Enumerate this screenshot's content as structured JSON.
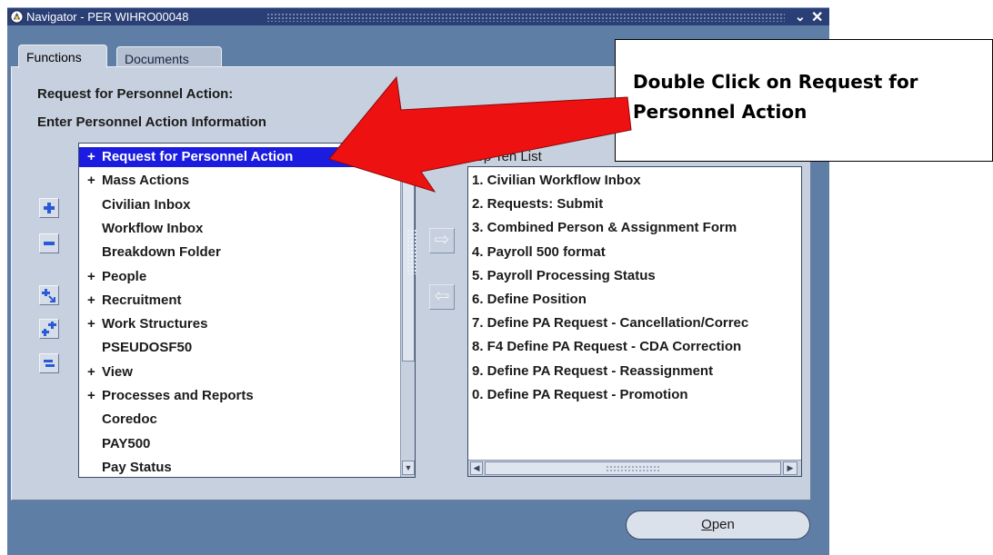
{
  "window": {
    "title": "Navigator - PER WIHRO00048",
    "minimize_glyph": "⌄",
    "close_glyph": "✕"
  },
  "tabs": [
    {
      "label": "Functions",
      "active": true
    },
    {
      "label": "Documents",
      "active": false
    }
  ],
  "header": {
    "line1": "Request for Personnel Action:",
    "line2": "Enter Personnel Action Information"
  },
  "tree": {
    "items": [
      {
        "label": "Request for Personnel Action",
        "expandable": true,
        "selected": true
      },
      {
        "label": "Mass Actions",
        "expandable": true,
        "selected": false
      },
      {
        "label": "Civilian Inbox",
        "expandable": false,
        "selected": false
      },
      {
        "label": "Workflow Inbox",
        "expandable": false,
        "selected": false
      },
      {
        "label": "Breakdown Folder",
        "expandable": false,
        "selected": false
      },
      {
        "label": "People",
        "expandable": true,
        "selected": false
      },
      {
        "label": "Recruitment",
        "expandable": true,
        "selected": false
      },
      {
        "label": "Work Structures",
        "expandable": true,
        "selected": false
      },
      {
        "label": "PSEUDOSF50",
        "expandable": false,
        "selected": false
      },
      {
        "label": "View",
        "expandable": true,
        "selected": false
      },
      {
        "label": "Processes and Reports",
        "expandable": true,
        "selected": false
      },
      {
        "label": "Coredoc",
        "expandable": false,
        "selected": false
      },
      {
        "label": "PAY500",
        "expandable": false,
        "selected": false
      },
      {
        "label": "Pay Status",
        "expandable": false,
        "selected": false
      }
    ],
    "plus_glyph": "+"
  },
  "top_ten": {
    "label": "Top Ten List",
    "items": [
      "1. Civilian Workflow Inbox",
      "2. Requests: Submit",
      "3. Combined Person & Assignment Form",
      "4. Payroll 500 format",
      "5. Payroll Processing Status",
      "6. Define  Position",
      "7. Define PA Request - Cancellation/Correc",
      "8. F4 Define PA Request - CDA Correction",
      "9. Define PA Request - Reassignment",
      "0. Define PA Request - Promotion"
    ]
  },
  "buttons": {
    "open_mnemonic": "O",
    "open_rest": "pen"
  },
  "callout": {
    "text": "Double Click on Request for Personnel Action"
  },
  "colors": {
    "selection": "#1c1ce0",
    "arrow": "#ee1111",
    "window_bg": "#5f7ea6",
    "panel_bg": "#c7d0de"
  }
}
